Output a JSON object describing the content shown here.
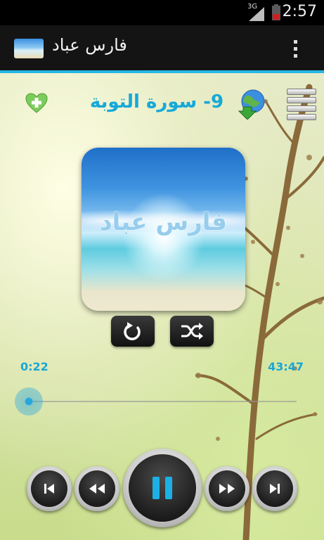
{
  "status_bar": {
    "network": "3G",
    "time": "2:57"
  },
  "app": {
    "title": "فارس عباد"
  },
  "player": {
    "track_title": "9- سورة التوبة",
    "album_art_text": "فارس عباد",
    "current_time": "0:22",
    "total_time": "43:47",
    "progress_fraction": 0.008
  },
  "colors": {
    "accent": "#26b6e6",
    "time_text": "#1aa7d5",
    "title_text": "#16a9d8"
  },
  "icons": {
    "favorite": "heart-plus-icon",
    "download": "globe-download-icon",
    "playlist": "list-icon",
    "repeat": "repeat-icon",
    "shuffle": "shuffle-icon",
    "skip_previous": "skip-previous-icon",
    "rewind": "rewind-icon",
    "play_pause": "pause-icon",
    "fast_forward": "fast-forward-icon",
    "skip_next": "skip-next-icon",
    "overflow": "overflow-menu-icon"
  }
}
